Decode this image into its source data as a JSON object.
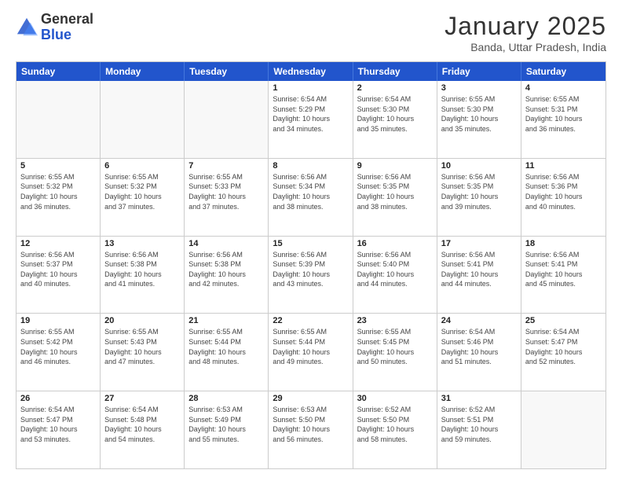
{
  "logo": {
    "general": "General",
    "blue": "Blue"
  },
  "title": "January 2025",
  "subtitle": "Banda, Uttar Pradesh, India",
  "days": [
    "Sunday",
    "Monday",
    "Tuesday",
    "Wednesday",
    "Thursday",
    "Friday",
    "Saturday"
  ],
  "weeks": [
    [
      {
        "num": "",
        "empty": true
      },
      {
        "num": "",
        "empty": true
      },
      {
        "num": "",
        "empty": true
      },
      {
        "num": "1",
        "info": "Sunrise: 6:54 AM\nSunset: 5:29 PM\nDaylight: 10 hours\nand 34 minutes."
      },
      {
        "num": "2",
        "info": "Sunrise: 6:54 AM\nSunset: 5:30 PM\nDaylight: 10 hours\nand 35 minutes."
      },
      {
        "num": "3",
        "info": "Sunrise: 6:55 AM\nSunset: 5:30 PM\nDaylight: 10 hours\nand 35 minutes."
      },
      {
        "num": "4",
        "info": "Sunrise: 6:55 AM\nSunset: 5:31 PM\nDaylight: 10 hours\nand 36 minutes."
      }
    ],
    [
      {
        "num": "5",
        "info": "Sunrise: 6:55 AM\nSunset: 5:32 PM\nDaylight: 10 hours\nand 36 minutes."
      },
      {
        "num": "6",
        "info": "Sunrise: 6:55 AM\nSunset: 5:32 PM\nDaylight: 10 hours\nand 37 minutes."
      },
      {
        "num": "7",
        "info": "Sunrise: 6:55 AM\nSunset: 5:33 PM\nDaylight: 10 hours\nand 37 minutes."
      },
      {
        "num": "8",
        "info": "Sunrise: 6:56 AM\nSunset: 5:34 PM\nDaylight: 10 hours\nand 38 minutes."
      },
      {
        "num": "9",
        "info": "Sunrise: 6:56 AM\nSunset: 5:35 PM\nDaylight: 10 hours\nand 38 minutes."
      },
      {
        "num": "10",
        "info": "Sunrise: 6:56 AM\nSunset: 5:35 PM\nDaylight: 10 hours\nand 39 minutes."
      },
      {
        "num": "11",
        "info": "Sunrise: 6:56 AM\nSunset: 5:36 PM\nDaylight: 10 hours\nand 40 minutes."
      }
    ],
    [
      {
        "num": "12",
        "info": "Sunrise: 6:56 AM\nSunset: 5:37 PM\nDaylight: 10 hours\nand 40 minutes."
      },
      {
        "num": "13",
        "info": "Sunrise: 6:56 AM\nSunset: 5:38 PM\nDaylight: 10 hours\nand 41 minutes."
      },
      {
        "num": "14",
        "info": "Sunrise: 6:56 AM\nSunset: 5:38 PM\nDaylight: 10 hours\nand 42 minutes."
      },
      {
        "num": "15",
        "info": "Sunrise: 6:56 AM\nSunset: 5:39 PM\nDaylight: 10 hours\nand 43 minutes."
      },
      {
        "num": "16",
        "info": "Sunrise: 6:56 AM\nSunset: 5:40 PM\nDaylight: 10 hours\nand 44 minutes."
      },
      {
        "num": "17",
        "info": "Sunrise: 6:56 AM\nSunset: 5:41 PM\nDaylight: 10 hours\nand 44 minutes."
      },
      {
        "num": "18",
        "info": "Sunrise: 6:56 AM\nSunset: 5:41 PM\nDaylight: 10 hours\nand 45 minutes."
      }
    ],
    [
      {
        "num": "19",
        "info": "Sunrise: 6:55 AM\nSunset: 5:42 PM\nDaylight: 10 hours\nand 46 minutes."
      },
      {
        "num": "20",
        "info": "Sunrise: 6:55 AM\nSunset: 5:43 PM\nDaylight: 10 hours\nand 47 minutes."
      },
      {
        "num": "21",
        "info": "Sunrise: 6:55 AM\nSunset: 5:44 PM\nDaylight: 10 hours\nand 48 minutes."
      },
      {
        "num": "22",
        "info": "Sunrise: 6:55 AM\nSunset: 5:44 PM\nDaylight: 10 hours\nand 49 minutes."
      },
      {
        "num": "23",
        "info": "Sunrise: 6:55 AM\nSunset: 5:45 PM\nDaylight: 10 hours\nand 50 minutes."
      },
      {
        "num": "24",
        "info": "Sunrise: 6:54 AM\nSunset: 5:46 PM\nDaylight: 10 hours\nand 51 minutes."
      },
      {
        "num": "25",
        "info": "Sunrise: 6:54 AM\nSunset: 5:47 PM\nDaylight: 10 hours\nand 52 minutes."
      }
    ],
    [
      {
        "num": "26",
        "info": "Sunrise: 6:54 AM\nSunset: 5:47 PM\nDaylight: 10 hours\nand 53 minutes."
      },
      {
        "num": "27",
        "info": "Sunrise: 6:54 AM\nSunset: 5:48 PM\nDaylight: 10 hours\nand 54 minutes."
      },
      {
        "num": "28",
        "info": "Sunrise: 6:53 AM\nSunset: 5:49 PM\nDaylight: 10 hours\nand 55 minutes."
      },
      {
        "num": "29",
        "info": "Sunrise: 6:53 AM\nSunset: 5:50 PM\nDaylight: 10 hours\nand 56 minutes."
      },
      {
        "num": "30",
        "info": "Sunrise: 6:52 AM\nSunset: 5:50 PM\nDaylight: 10 hours\nand 58 minutes."
      },
      {
        "num": "31",
        "info": "Sunrise: 6:52 AM\nSunset: 5:51 PM\nDaylight: 10 hours\nand 59 minutes."
      },
      {
        "num": "",
        "empty": true
      }
    ]
  ]
}
